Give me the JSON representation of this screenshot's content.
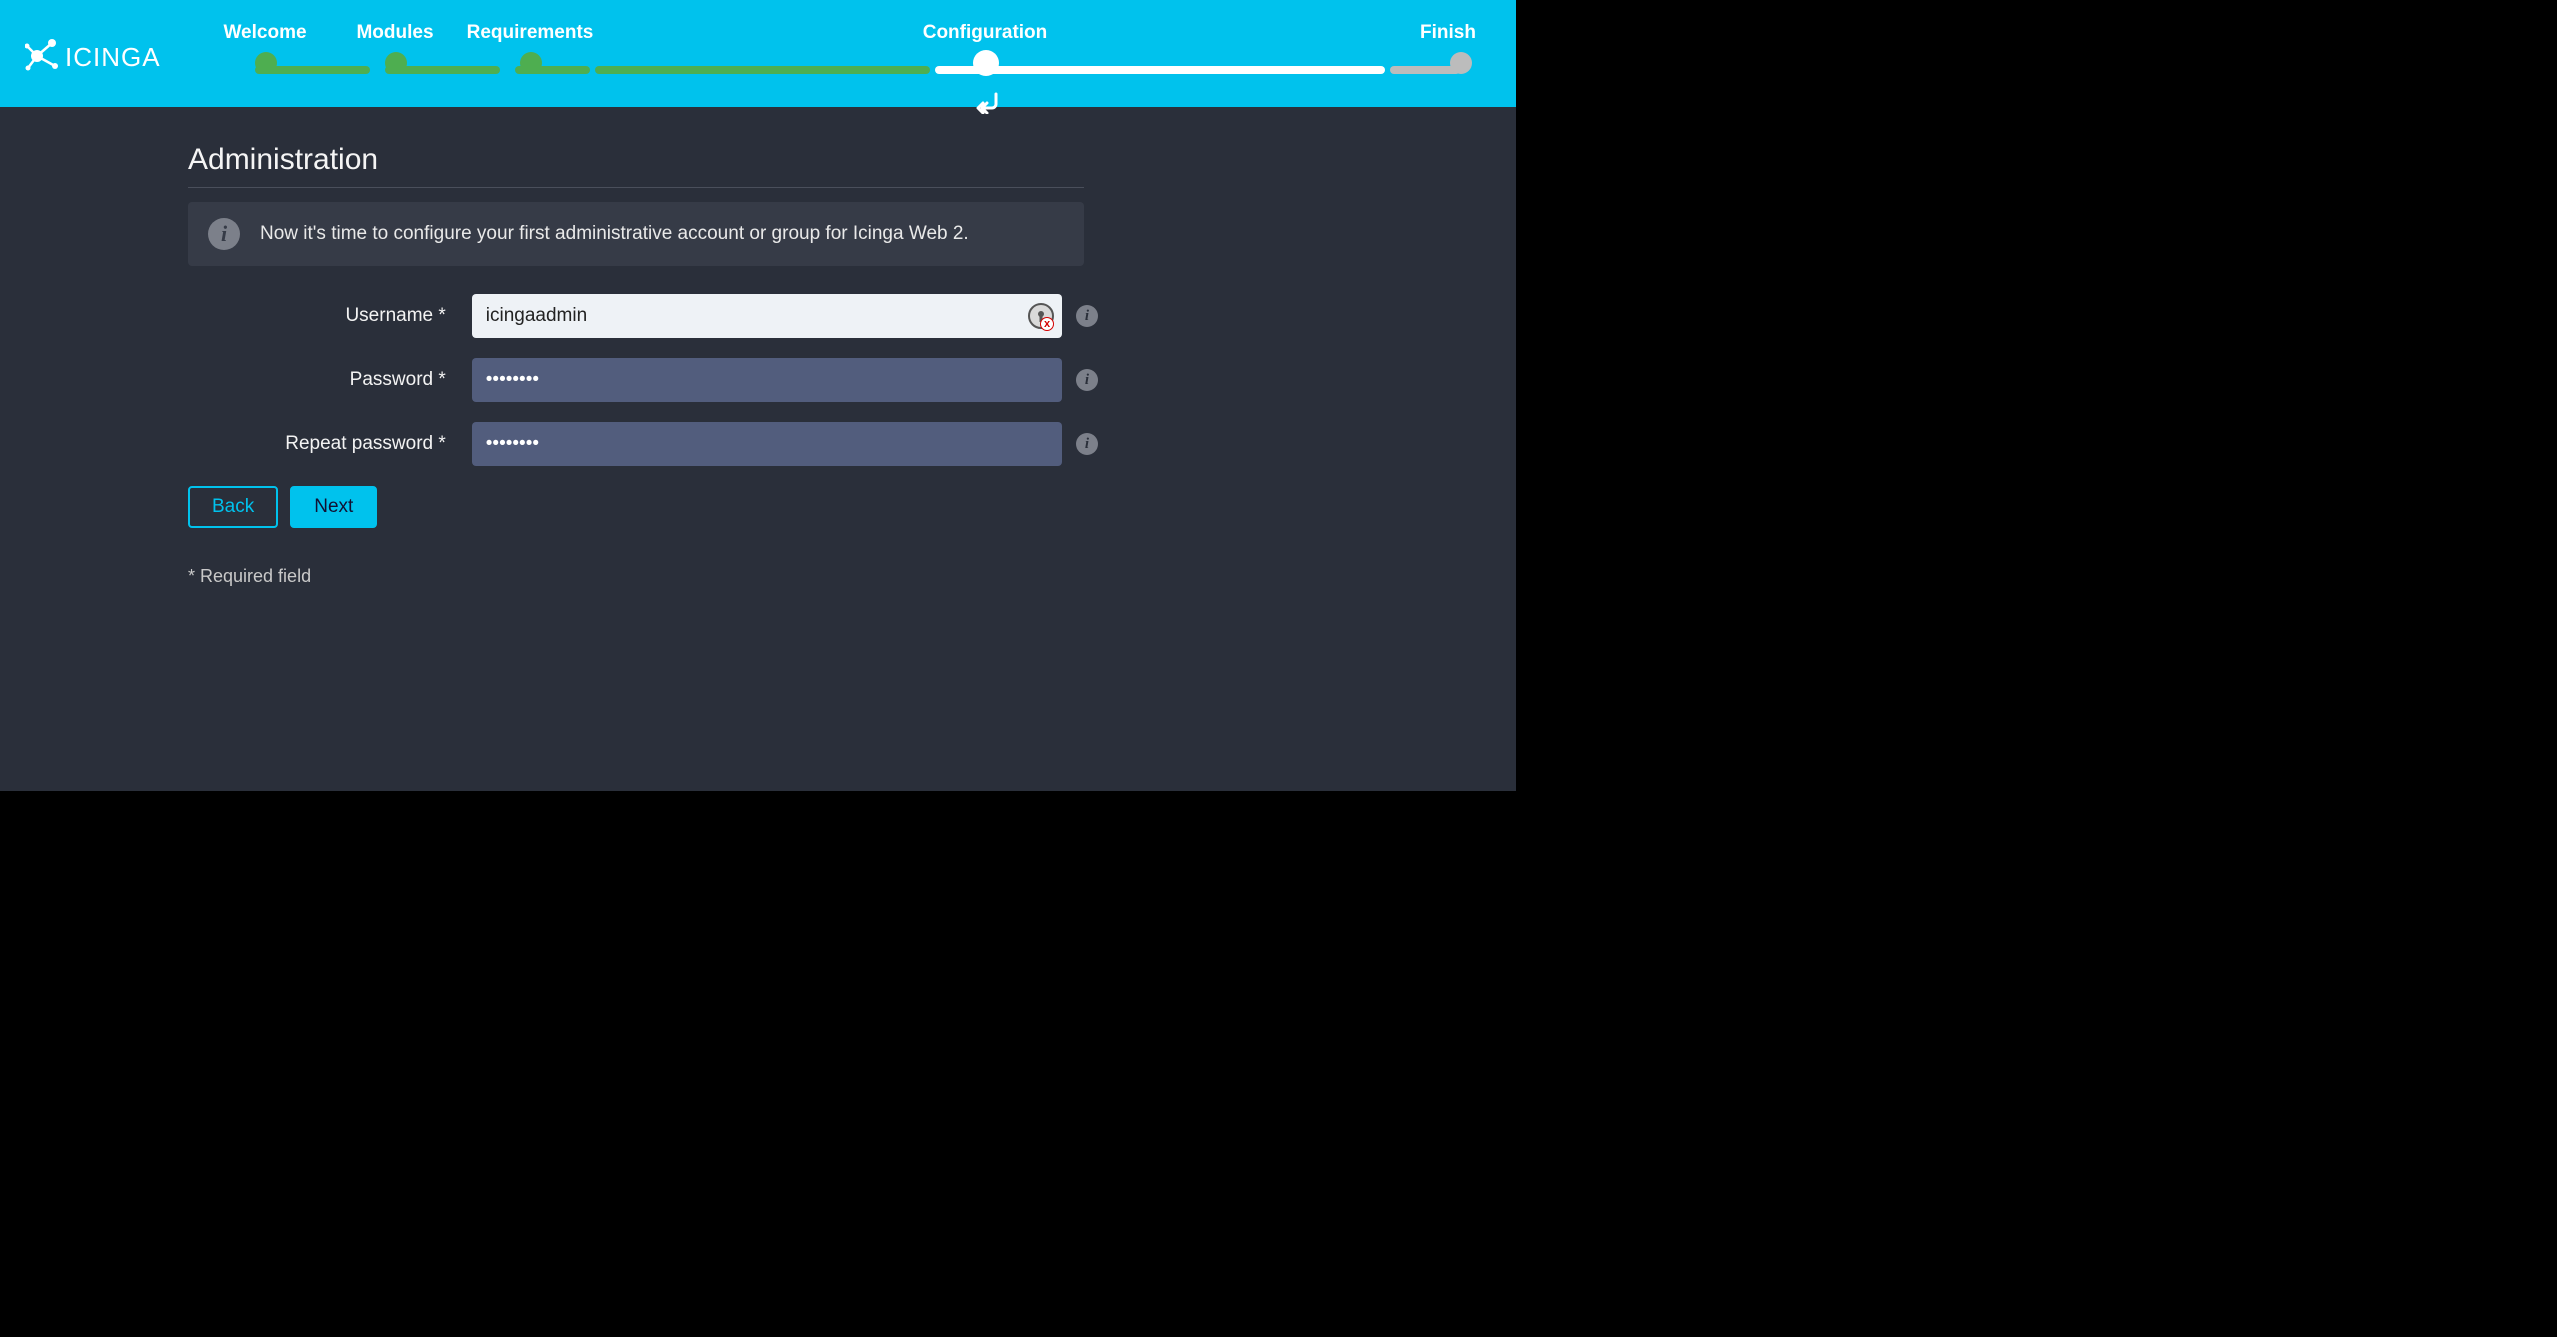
{
  "brand": "ICINGA",
  "wizard": {
    "steps": {
      "welcome": "Welcome",
      "modules": "Modules",
      "requirements": "Requirements",
      "configuration": "Configuration",
      "finish": "Finish"
    }
  },
  "page": {
    "title": "Administration",
    "info": "Now it's time to configure your first administrative account or group for Icinga Web 2."
  },
  "form": {
    "username_label": "Username *",
    "username_value": "icingaadmin",
    "password_label": "Password *",
    "password_value": "••••••••",
    "repeat_label": "Repeat password *",
    "repeat_value": "••••••••"
  },
  "buttons": {
    "back": "Back",
    "next": "Next"
  },
  "footer": {
    "required": "* Required field"
  }
}
